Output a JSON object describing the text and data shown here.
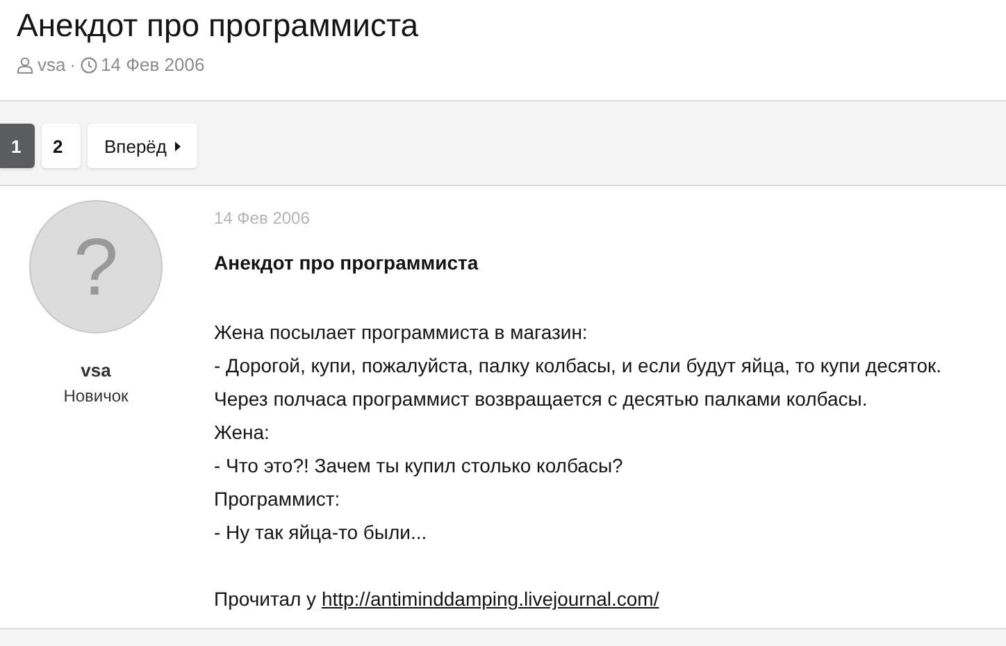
{
  "thread": {
    "title": "Анекдот про программиста",
    "author": "vsa",
    "separator": "·",
    "date": "14 Фев 2006"
  },
  "pagination": {
    "pages": [
      {
        "label": "1",
        "selected": true
      },
      {
        "label": "2",
        "selected": false
      }
    ],
    "next": "Вперёд"
  },
  "post": {
    "author": {
      "name": "vsa",
      "role": "Новичок",
      "avatar": "?"
    },
    "date": "14 Фев 2006",
    "title": "Анекдот про программиста",
    "lines": [
      "Жена посылает программиста в магазин:",
      "- Дорогой, купи, пожалуйста, палку колбасы, и если будут яйца, то купи десяток.",
      "Через полчаса программист возвращается с десятью палками колбасы.",
      "Жена:",
      "- Что это?! Зачем ты купил столько колбасы?",
      "Программист:",
      "- Ну так яйца-то были..."
    ],
    "source": {
      "prefix": "Прочитал у",
      "link": "http://antiminddamping.livejournal.com/"
    }
  }
}
